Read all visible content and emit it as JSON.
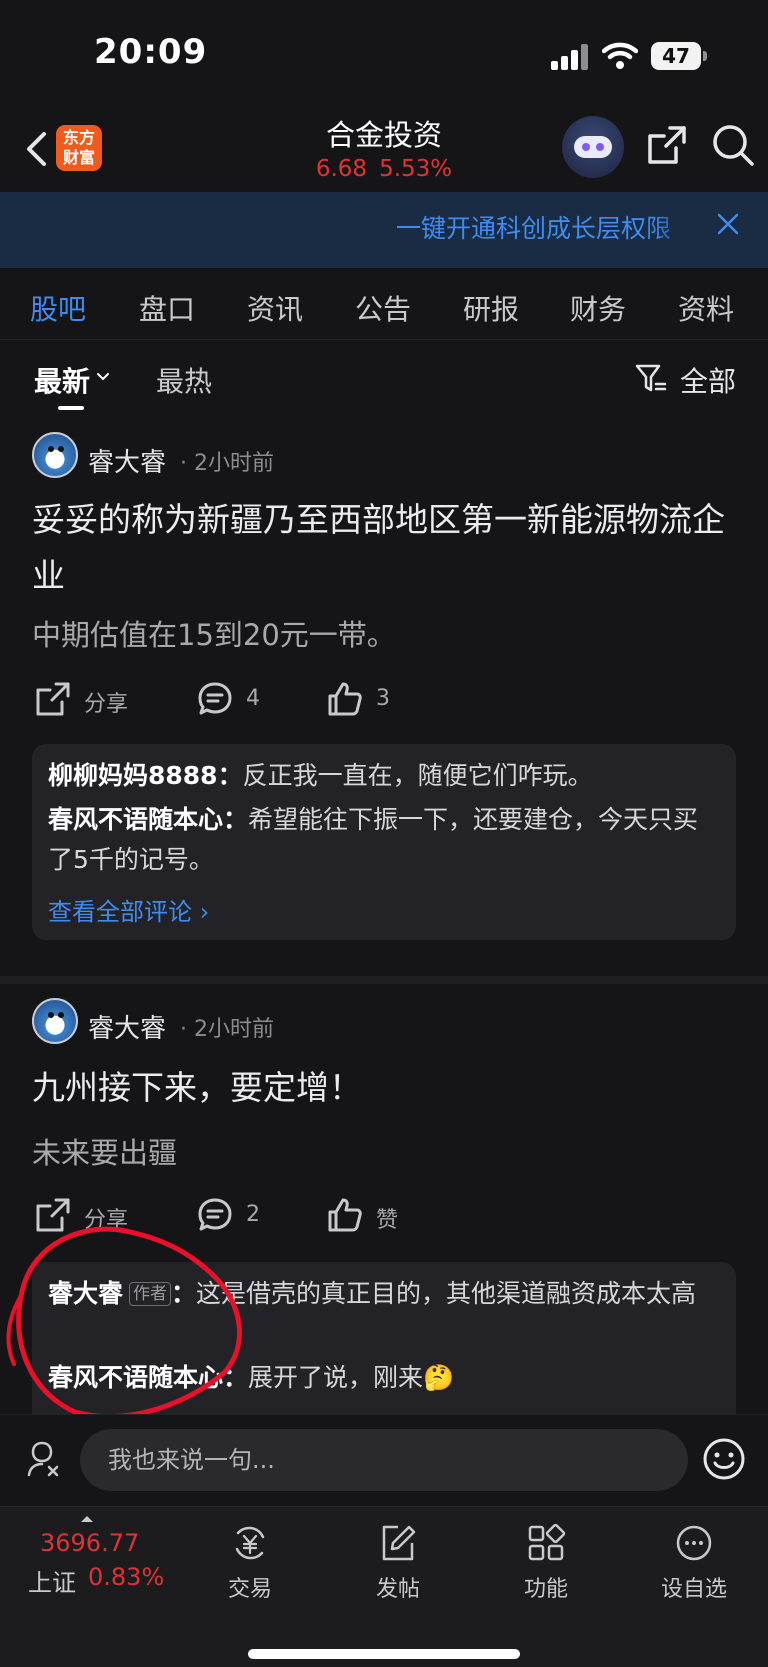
{
  "status_bar": {
    "time": "20:09",
    "battery": "47"
  },
  "nav": {
    "logo_line1": "东方",
    "logo_line2": "财富",
    "title": "合金投资",
    "price": "6.68",
    "change_pct": "5.53%",
    "price_color": "#e03234"
  },
  "promo": {
    "text": "一键开通科创成长层权限"
  },
  "tabs": [
    {
      "label": "股吧",
      "active": true
    },
    {
      "label": "盘口"
    },
    {
      "label": "资讯"
    },
    {
      "label": "公告"
    },
    {
      "label": "研报"
    },
    {
      "label": "财务"
    },
    {
      "label": "资料"
    }
  ],
  "filters": {
    "latest": "最新",
    "hot": "最热",
    "all": "全部"
  },
  "posts": [
    {
      "author": "睿大睿",
      "time": "· 2小时前",
      "title": "妥妥的称为新疆乃至西部地区第一新能源物流企业",
      "body": "中期估值在15到20元一带。",
      "share_label": "分享",
      "comment_count": "4",
      "like_label": "3",
      "comments": [
        {
          "user": "柳柳妈妈8888",
          "text": "反正我一直在，随便它们咋玩。"
        },
        {
          "user": "春风不语随本心",
          "text": "希望能往下振一下，还要建仓，今天只买了5千的记号。"
        }
      ],
      "view_all": "查看全部评论 ›"
    },
    {
      "author": "睿大睿",
      "time": "· 2小时前",
      "title": "九州接下来，要定增！",
      "body": "未来要出疆",
      "share_label": "分享",
      "comment_count": "2",
      "like_label": "赞",
      "comments": [
        {
          "user": "睿大睿",
          "tag": "作者",
          "text": "这是借壳的真正目的，其他渠道融资成本太高"
        },
        {
          "user": "春风不语随本心",
          "text": "展开了说，刚来🤔"
        }
      ]
    }
  ],
  "input": {
    "placeholder": "我也来说一句..."
  },
  "bottom_bar": {
    "index_value": "3696.77",
    "index_name": "上证",
    "index_pct": "0.83%",
    "items": [
      "交易",
      "发帖",
      "功能",
      "设自选"
    ]
  },
  "colors": {
    "accent": "#3f8cf0",
    "up": "#e03234",
    "background": "#151517",
    "annotation": "#e8102a"
  },
  "icons": [
    "back-icon",
    "share-icon",
    "search-icon",
    "close-icon",
    "filter-icon",
    "comment-icon",
    "like-icon",
    "mic-icon",
    "emoji-icon",
    "trade-icon",
    "post-icon",
    "function-icon",
    "watchlist-icon"
  ]
}
